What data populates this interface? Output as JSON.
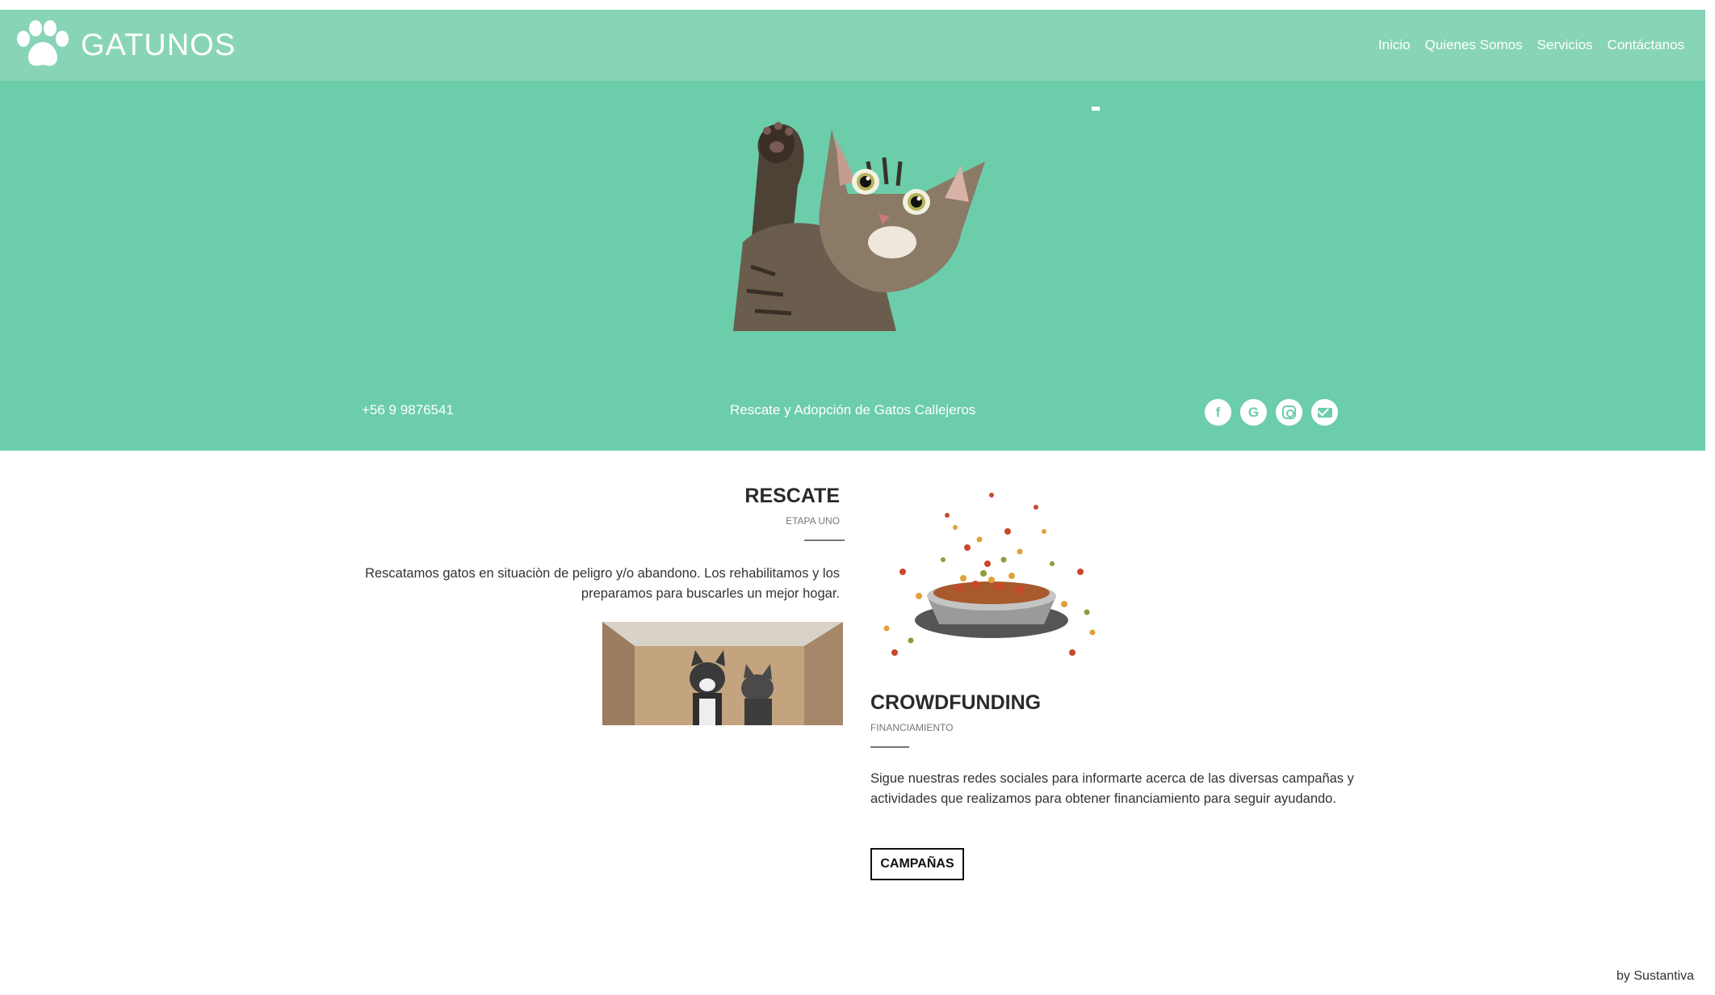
{
  "brand": {
    "name": "GATUNOS",
    "logo_icon": "paw-icon"
  },
  "nav": {
    "items": [
      {
        "label": "Inicio"
      },
      {
        "label": "Quienes Somos"
      },
      {
        "label": "Servicios"
      },
      {
        "label": "Contáctanos"
      }
    ]
  },
  "hero": {
    "phone": "+56 9 9876541",
    "tagline": "Rescate y Adopción de Gatos Callejeros",
    "social_icons": [
      "facebook-icon",
      "google-icon",
      "instagram-icon",
      "email-icon"
    ]
  },
  "rescate": {
    "title": "RESCATE",
    "subtitle": "ETAPA UNO",
    "text": "Rescatamos gatos en situaciòn de peligro y/o abandono. Los rehabilitamos y los preparamos para buscarles un mejor hogar."
  },
  "crowdfunding": {
    "title": "CROWDFUNDING",
    "subtitle": "FINANCIAMIENTO",
    "text": "Sigue nuestras redes sociales para informarte acerca de las diversas campañas y actividades que realizamos para obtener financiamiento para seguir ayudando.",
    "button_label": "CAMPAÑAS"
  },
  "footer": {
    "credit": "by Sustantiva"
  },
  "colors": {
    "navbar": "#88d4b7",
    "hero": "#6ccdab",
    "text": "#333333"
  }
}
